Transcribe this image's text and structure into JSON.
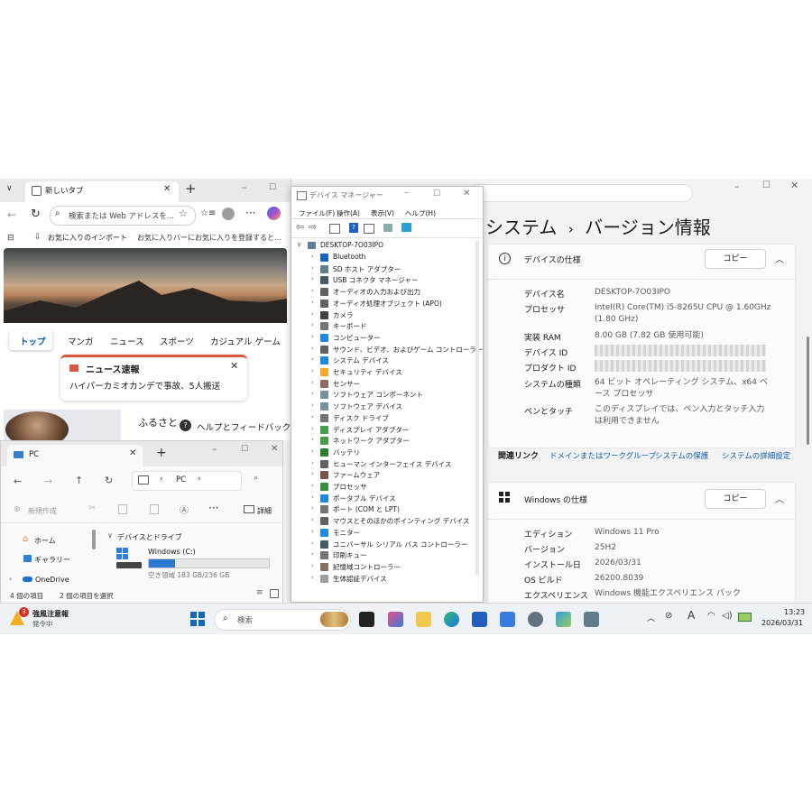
{
  "edge": {
    "tab_title": "新しいタブ",
    "address_placeholder": "検索または Web アドレスを...",
    "fav_import": "お気に入りのインポート",
    "fav_bar_hint": "お気に入りバーにお気に入りを登録すると...",
    "nav_tabs": [
      "トップ",
      "マンガ",
      "ニュース",
      "スポーツ",
      "カジュアル ゲーム"
    ],
    "news_flash_title": "ニュース速報",
    "news_flash_text": "ハイパーカミオカンデで事故、5人搬送",
    "furusato": "ふるさと",
    "help_feedback": "ヘルプとフィードバック"
  },
  "explorer": {
    "tab_title": "PC",
    "breadcrumb": "PC",
    "new_button": "新規作成",
    "details_button": "詳細",
    "nav": [
      "ホーム",
      "ギャラリー",
      "OneDrive"
    ],
    "group_header": "デバイスとドライブ",
    "drive_name": "Windows (C:)",
    "drive_free": "空き領域 183 GB/236 GB",
    "drive_used_fraction": 0.22,
    "status_items": "4 個の項目",
    "status_selected": "2 個の項目を選択"
  },
  "devmgr": {
    "title": "デバイス マネージャー",
    "menu": [
      "ファイル(F)",
      "操作(A)",
      "表示(V)",
      "ヘルプ(H)"
    ],
    "root": "DESKTOP-7O03IPO",
    "items": [
      {
        "label": "Bluetooth",
        "color": "#1565c0"
      },
      {
        "label": "SD ホスト アダプター",
        "color": "#607d8b"
      },
      {
        "label": "USB コネクタ マネージャー",
        "color": "#455a64"
      },
      {
        "label": "オーディオの入力および出力",
        "color": "#616161"
      },
      {
        "label": "オーディオ処理オブジェクト (APO)",
        "color": "#616161"
      },
      {
        "label": "カメラ",
        "color": "#424242"
      },
      {
        "label": "キーボード",
        "color": "#757575"
      },
      {
        "label": "コンピューター",
        "color": "#1e88e5"
      },
      {
        "label": "サウンド、ビデオ、およびゲーム コントローラー",
        "color": "#616161"
      },
      {
        "label": "システム デバイス",
        "color": "#1e88e5"
      },
      {
        "label": "セキュリティ デバイス",
        "color": "#f9a825"
      },
      {
        "label": "センサー",
        "color": "#8d6e63"
      },
      {
        "label": "ソフトウェア コンポーネント",
        "color": "#78909c"
      },
      {
        "label": "ソフトウェア デバイス",
        "color": "#78909c"
      },
      {
        "label": "ディスク ドライブ",
        "color": "#757575"
      },
      {
        "label": "ディスプレイ アダプター",
        "color": "#43a047"
      },
      {
        "label": "ネットワーク アダプター",
        "color": "#43a047"
      },
      {
        "label": "バッテリ",
        "color": "#2e7d32"
      },
      {
        "label": "ヒューマン インターフェイス デバイス",
        "color": "#616161"
      },
      {
        "label": "ファームウェア",
        "color": "#795548"
      },
      {
        "label": "プロセッサ",
        "color": "#388e3c"
      },
      {
        "label": "ポータブル デバイス",
        "color": "#1e88e5"
      },
      {
        "label": "ポート (COM と LPT)",
        "color": "#757575"
      },
      {
        "label": "マウスとそのほかのポインティング デバイス",
        "color": "#616161"
      },
      {
        "label": "モニター",
        "color": "#1e88e5"
      },
      {
        "label": "ユニバーサル シリアル バス コントローラー",
        "color": "#455a64"
      },
      {
        "label": "印刷キュー",
        "color": "#757575"
      },
      {
        "label": "記憶域コントローラー",
        "color": "#8d6e63"
      },
      {
        "label": "生体認証デバイス",
        "color": "#9e9e9e"
      }
    ]
  },
  "settings": {
    "breadcrumb_parent": "システム",
    "breadcrumb_sep": "›",
    "page_title": "バージョン情報",
    "device_spec_title": "デバイスの仕様",
    "copy_label": "コピー",
    "device_rows": [
      {
        "label": "デバイス名",
        "value": "DESKTOP-7O03IPO"
      },
      {
        "label": "プロセッサ",
        "value": "Intel(R) Core(TM) i5-8265U CPU @ 1.60GHz (1.80 GHz)"
      },
      {
        "label": "実装 RAM",
        "value": "8.00 GB (7.82 GB 使用可能)"
      },
      {
        "label": "デバイス ID",
        "value": ""
      },
      {
        "label": "プロダクト ID",
        "value": ""
      },
      {
        "label": "システムの種類",
        "value": "64 ビット オペレーティング システム、x64 ベース プロセッサ"
      },
      {
        "label": "ペンとタッチ",
        "value": "このディスプレイでは、ペン入力とタッチ入力は利用できません"
      }
    ],
    "related_links_label": "関連リンク",
    "related_links": [
      "ドメインまたはワークグループ",
      "システムの保護",
      "システムの詳細設定"
    ],
    "windows_spec_title": "Windows の仕様",
    "windows_rows": [
      {
        "label": "エディション",
        "value": "Windows 11 Pro"
      },
      {
        "label": "バージョン",
        "value": "25H2"
      },
      {
        "label": "インストール日",
        "value": "2026/03/31"
      },
      {
        "label": "OS ビルド",
        "value": "26200.8039"
      },
      {
        "label": "エクスペリエンス",
        "value": "Windows 機能エクスペリエンス パック"
      }
    ]
  },
  "taskbar": {
    "weather_badge": "3",
    "weather_title": "強風注意報",
    "weather_sub": "発令中",
    "search_placeholder": "検索",
    "ime": "A",
    "time": "13:23",
    "date": "2026/03/31"
  }
}
